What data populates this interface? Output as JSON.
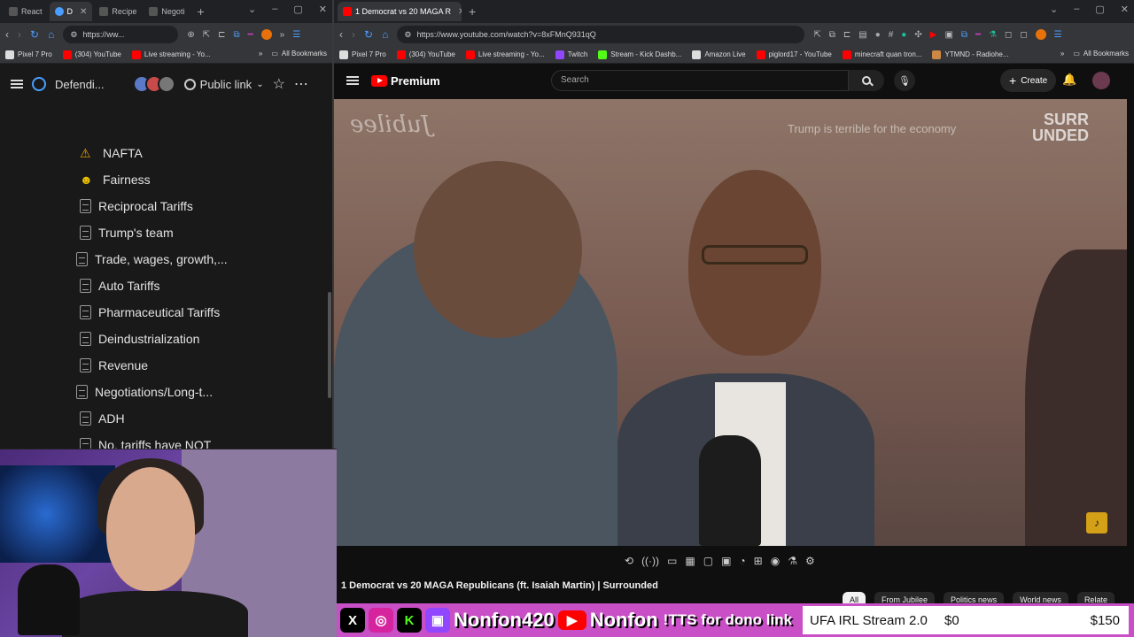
{
  "left_browser": {
    "tabs": [
      {
        "label": "React",
        "color": "#e8e8e8"
      },
      {
        "label": "D",
        "color": "#4a9eff"
      },
      {
        "label": "Recipe",
        "color": "#e8e8e8"
      },
      {
        "label": "Negoti",
        "color": "#e8e8e8"
      }
    ],
    "url": "https://ww...",
    "bookmarks": [
      {
        "label": "Pixel 7 Pro",
        "color": "#ddd"
      },
      {
        "label": "(304) YouTube",
        "color": "#ff0000"
      },
      {
        "label": "Live streaming - Yo...",
        "color": "#ff0000"
      }
    ],
    "all_bookmarks": "All Bookmarks"
  },
  "notion": {
    "title": "Defendi...",
    "share_label": "Public link",
    "pages": [
      {
        "icon": "⚠",
        "label": "NAFTA"
      },
      {
        "icon": "☻",
        "label": "Fairness"
      },
      {
        "icon": "doc",
        "label": "Reciprocal Tariffs"
      },
      {
        "icon": "doc",
        "label": "Trump's team"
      },
      {
        "icon": "doc",
        "label": "Trade, wages, growth,..."
      },
      {
        "icon": "doc",
        "label": "Auto Tariffs"
      },
      {
        "icon": "doc",
        "label": "Pharmaceutical Tariffs"
      },
      {
        "icon": "doc",
        "label": "Deindustrialization"
      },
      {
        "icon": "doc",
        "label": "Revenue"
      },
      {
        "icon": "doc",
        "label": "Negotiations/Long-t..."
      },
      {
        "icon": "doc",
        "label": "ADH"
      },
      {
        "icon": "doc",
        "label": "No, tariffs have NOT"
      }
    ]
  },
  "right_browser": {
    "tab": {
      "label": "1 Democrat vs 20 MAGA R",
      "color": "#ff0000"
    },
    "url": "https://www.youtube.com/watch?v=8xFMnQ931qQ",
    "bookmarks": [
      {
        "label": "Pixel 7 Pro",
        "color": "#ddd"
      },
      {
        "label": "(304) YouTube",
        "color": "#ff0000"
      },
      {
        "label": "Live streaming - Yo...",
        "color": "#ff0000"
      },
      {
        "label": "Twitch",
        "color": "#9146ff"
      },
      {
        "label": "Stream - Kick Dashb...",
        "color": "#53fc18"
      },
      {
        "label": "Amazon Live",
        "color": "#ddd"
      },
      {
        "label": "piglord17 - YouTube",
        "color": "#ff0000"
      },
      {
        "label": "minecraft quan tron...",
        "color": "#ff0000"
      },
      {
        "label": "YTMND - Radiohe...",
        "color": "#cc8844"
      }
    ],
    "all_bookmarks": "All Bookmarks"
  },
  "youtube": {
    "logo": "Premium",
    "search_placeholder": "Search",
    "create_label": "Create",
    "video": {
      "watermark": "Jubilee",
      "caption": "Trump is terrible for the economy",
      "brand_line1": "SURR",
      "brand_line2": "UNDED"
    },
    "title": "1 Democrat vs 20 MAGA Republicans (ft. Isaiah Martin) | Surrounded",
    "chips": [
      "All",
      "From Jubilee",
      "Politics news",
      "World news",
      "Relate"
    ]
  },
  "overlay": {
    "handle_1": "Nonfon420",
    "handle_2": "Nonfon",
    "tts": "!TTS for dono link",
    "goal_name": "UFA IRL Stream 2.0",
    "goal_current": "$0",
    "goal_target": "$150",
    "goal_progress": 0
  }
}
